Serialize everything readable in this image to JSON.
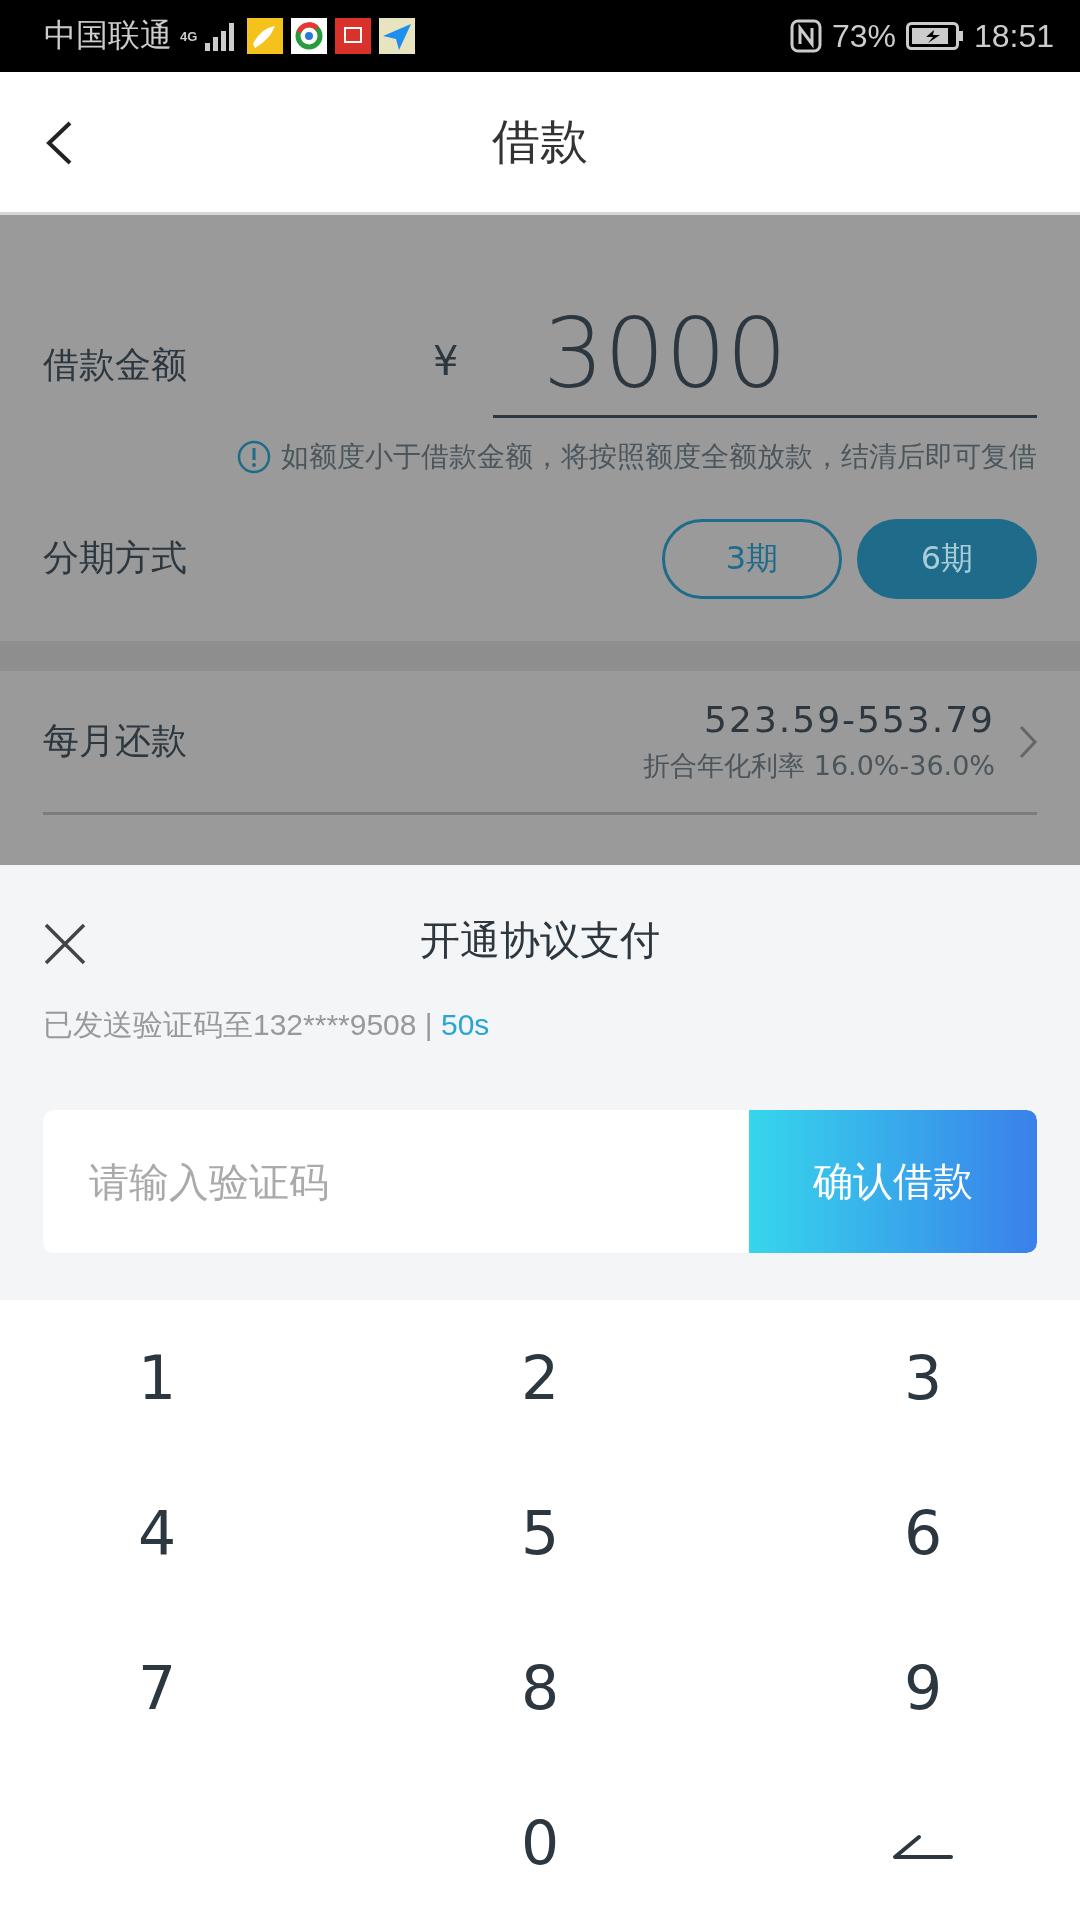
{
  "status_bar": {
    "carrier": "中国联通",
    "network": "4G",
    "battery": "73%",
    "time": "18:51"
  },
  "header": {
    "title": "借款"
  },
  "amount": {
    "label": "借款金额",
    "currency": "¥",
    "value": "3000",
    "hint": "如额度小于借款金额，将按照额度全额放款，结清后即可复借"
  },
  "installment": {
    "label": "分期方式",
    "options": [
      {
        "label": "3期",
        "selected": false
      },
      {
        "label": "6期",
        "selected": true
      }
    ]
  },
  "monthly": {
    "label": "每月还款",
    "value": "523.59-553.79",
    "rate": "折合年化利率 16.0%-36.0%"
  },
  "sheet": {
    "title": "开通协议支付",
    "sent_text": "已发送验证码至132****9508 | ",
    "countdown": "50s",
    "code_placeholder": "请输入验证码",
    "confirm": "确认借款"
  },
  "keypad": [
    {
      "kind": "digit",
      "label": "1"
    },
    {
      "kind": "digit",
      "label": "2"
    },
    {
      "kind": "digit",
      "label": "3"
    },
    {
      "kind": "digit",
      "label": "4"
    },
    {
      "kind": "digit",
      "label": "5"
    },
    {
      "kind": "digit",
      "label": "6"
    },
    {
      "kind": "digit",
      "label": "7"
    },
    {
      "kind": "digit",
      "label": "8"
    },
    {
      "kind": "digit",
      "label": "9"
    },
    {
      "kind": "blank"
    },
    {
      "kind": "digit",
      "label": "0"
    },
    {
      "kind": "delete"
    }
  ]
}
